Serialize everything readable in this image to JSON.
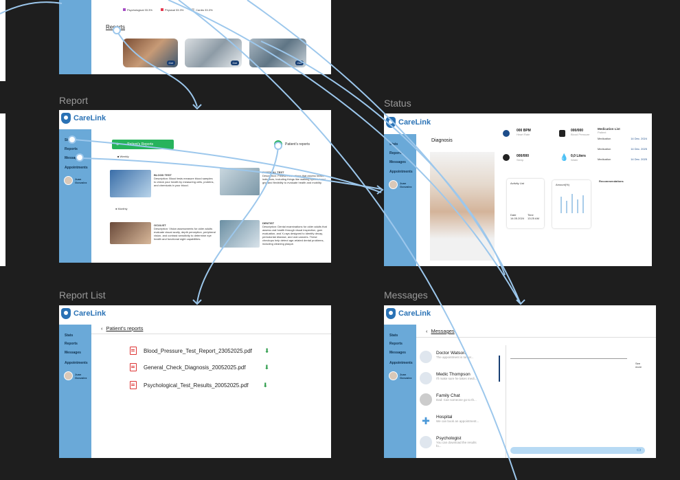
{
  "frames": {
    "report": "Report",
    "status": "Status",
    "report_list": "Report List",
    "messages": "Messages"
  },
  "brand": "CareLink",
  "nav": {
    "stats": "Stats",
    "reports": "Reports",
    "messages": "Messages",
    "appointments": "Appointments"
  },
  "user": {
    "first": "Juan",
    "last": "Gonzalez"
  },
  "top_frame": {
    "reports_title": "Reports",
    "legend": [
      "Psychological 33.3%",
      "Physical 33.3%",
      "Cardio 33.3%"
    ],
    "get": "Get"
  },
  "report": {
    "add_button": "Patient's Reports",
    "radio_label": "Patient's reports",
    "weekly": "Weekly",
    "monthly": "Monthly",
    "cards": [
      {
        "title": "BLOOD TEST",
        "body": "Description: Blood tests measure blood samples to check your health by measuring cells, proteins, and chemicals in your blood."
      },
      {
        "title": "PHYSICAL TEST",
        "body": "Description: Fitness evaluations that assess health indicators, including things like walking speed, hand grip and flexibility to evaluate health and mobility."
      },
      {
        "title": "OCULIST",
        "body": "Description: Vision assessments for older adults evaluate visual acuity, depth perception, peripheral vision, and contrast sensitivity to determine eye health and functional sight capabilities."
      },
      {
        "title": "DENTIST",
        "body": "Description: Dental examinations for older adults that assess oral health through visual inspection, gum evaluation, and X-rays designed to identify decay, periodontal disease, and oral cancers. These checkups help detect age-related dental problems, including cleaning plaque."
      }
    ]
  },
  "status": {
    "diagnosis": "Diagnosis",
    "heart": "000 BPM",
    "heart_label": "Heart Rate",
    "pressure": "000/000",
    "pressure_label": "Blood Pressure",
    "weight": "000/000",
    "weight_label": "Sleep",
    "water": "0,0 Liters",
    "water_label": "Water",
    "med_title": "Medication List",
    "med_label": "Patient",
    "meds": [
      {
        "name": "Medication",
        "date": "14 Dec. 2024"
      },
      {
        "name": "Medication",
        "date": "14 Dec. 2025"
      },
      {
        "name": "Medication",
        "date": "14 Dec. 2025"
      }
    ],
    "activity": "Activity List",
    "amount": "Amount(%)",
    "recommendations": "Recommendations",
    "date_label": "Date",
    "date_val": "14.05.2024",
    "time_label": "Time",
    "time_val": "13:25 AM"
  },
  "report_list": {
    "title": "Patient's reports",
    "files": [
      "Blood_Pressure_Test_Report_23052025.pdf",
      "General_Check_Diagnosis_20052025.pdf",
      "Psychological_Test_Results_20052025.pdf"
    ]
  },
  "messages": {
    "title": "Messages",
    "see_more": "See more",
    "items": [
      {
        "name": "Doctor Watson",
        "preview": "The appointment is tomor..."
      },
      {
        "name": "Medic Thompson",
        "preview": "I'll make sure he takes medi..."
      },
      {
        "name": "Family Chat",
        "preview": "Dad: Can someone go to th..."
      },
      {
        "name": "Hospital",
        "preview": "We can book an appointment..."
      },
      {
        "name": "Psychologist",
        "preview": "You can download the results fo..."
      }
    ]
  }
}
